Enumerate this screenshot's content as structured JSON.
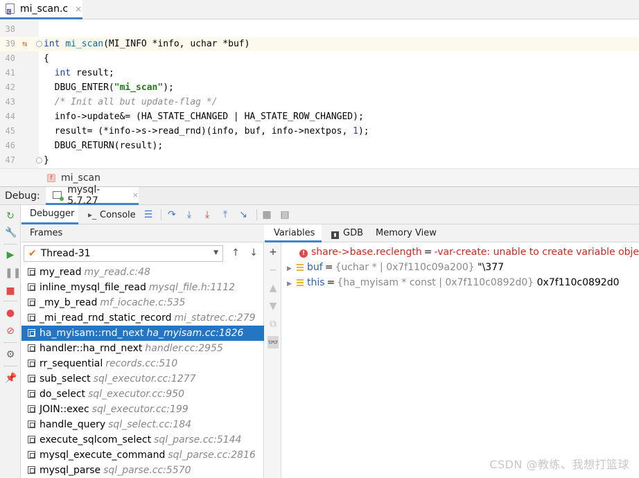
{
  "file_tab": {
    "name": "mi_scan.c",
    "close": "×",
    "icon": "c-file-icon"
  },
  "code": {
    "lines": [
      {
        "num": "38",
        "text": ""
      },
      {
        "num": "39",
        "text": "int mi_scan(MI_INFO *info, uchar *buf)"
      },
      {
        "num": "40",
        "text": "{"
      },
      {
        "num": "41",
        "text": "  int result;"
      },
      {
        "num": "42",
        "text": "  DBUG_ENTER(\"mi_scan\");"
      },
      {
        "num": "43",
        "text": "  /* Init all but update-flag */"
      },
      {
        "num": "44",
        "text": "  info->update&= (HA_STATE_CHANGED | HA_STATE_ROW_CHANGED);"
      },
      {
        "num": "45",
        "text": "  result= (*info->s->read_rnd)(info, buf, info->nextpos, 1);"
      },
      {
        "num": "46",
        "text": "  DBUG_RETURN(result);"
      },
      {
        "num": "47",
        "text": "}"
      }
    ]
  },
  "breadcrumb": {
    "badge": "f",
    "label": "mi_scan"
  },
  "debug": {
    "label": "Debug:",
    "session": "mysql-5.7.27",
    "session_close": "×",
    "tabs": {
      "debugger": "Debugger",
      "console": "Console"
    }
  },
  "frames": {
    "header": "Frames",
    "thread": "Thread-31",
    "rows": [
      {
        "fn": "my_read",
        "loc": "my_read.c:48"
      },
      {
        "fn": "inline_mysql_file_read",
        "loc": "mysql_file.h:1112"
      },
      {
        "fn": "_my_b_read",
        "loc": "mf_iocache.c:535"
      },
      {
        "fn": "_mi_read_rnd_static_record",
        "loc": "mi_statrec.c:279"
      },
      {
        "fn": "ha_myisam::rnd_next",
        "loc": "ha_myisam.cc:1826",
        "selected": true
      },
      {
        "fn": "handler::ha_rnd_next",
        "loc": "handler.cc:2955"
      },
      {
        "fn": "rr_sequential",
        "loc": "records.cc:510"
      },
      {
        "fn": "sub_select",
        "loc": "sql_executor.cc:1277"
      },
      {
        "fn": "do_select",
        "loc": "sql_executor.cc:950"
      },
      {
        "fn": "JOIN::exec",
        "loc": "sql_executor.cc:199"
      },
      {
        "fn": "handle_query",
        "loc": "sql_select.cc:184"
      },
      {
        "fn": "execute_sqlcom_select",
        "loc": "sql_parse.cc:5144"
      },
      {
        "fn": "mysql_execute_command",
        "loc": "sql_parse.cc:2816"
      },
      {
        "fn": "mysql_parse",
        "loc": "sql_parse.cc:5570"
      }
    ]
  },
  "variables": {
    "tabs": {
      "variables": "Variables",
      "gdb": "GDB",
      "memory": "Memory View"
    },
    "rows": [
      {
        "name": "share->base.reclength",
        "eq": "=",
        "type": "",
        "value": "-var-create: unable to create variable object",
        "error": true
      },
      {
        "name": "buf",
        "eq": "=",
        "type": "{uchar * | 0x7f110c09a200}",
        "value": "\"\\377"
      },
      {
        "name": "this",
        "eq": "=",
        "type": "{ha_myisam * const | 0x7f110c0892d0}",
        "value": "0x7f110c0892d0"
      }
    ]
  },
  "watermark": "CSDN @教练、我想打篮球",
  "colors": {
    "accent": "#4083c9",
    "selection": "#2475c3",
    "error": "#d02626",
    "keyword": "#1f3fa8",
    "string": "#1a7d1a"
  }
}
